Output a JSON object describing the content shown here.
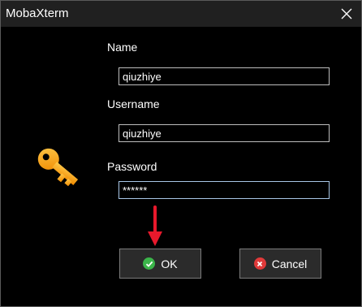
{
  "window": {
    "title": "MobaXterm"
  },
  "form": {
    "name_label": "Name",
    "name_value": "qiuzhiye",
    "username_label": "Username",
    "username_value": "qiuzhiye",
    "password_label": "Password",
    "password_value": "******"
  },
  "buttons": {
    "ok_label": "OK",
    "cancel_label": "Cancel"
  },
  "icons": {
    "key": "key-icon",
    "close": "close-icon",
    "ok": "check-circle-icon",
    "cancel": "x-circle-icon",
    "annotation": "red-down-arrow"
  },
  "colors": {
    "ok_green": "#3bb54a",
    "cancel_red": "#e03a3a",
    "key_orange": "#f5a623",
    "arrow_red": "#e8192c"
  }
}
